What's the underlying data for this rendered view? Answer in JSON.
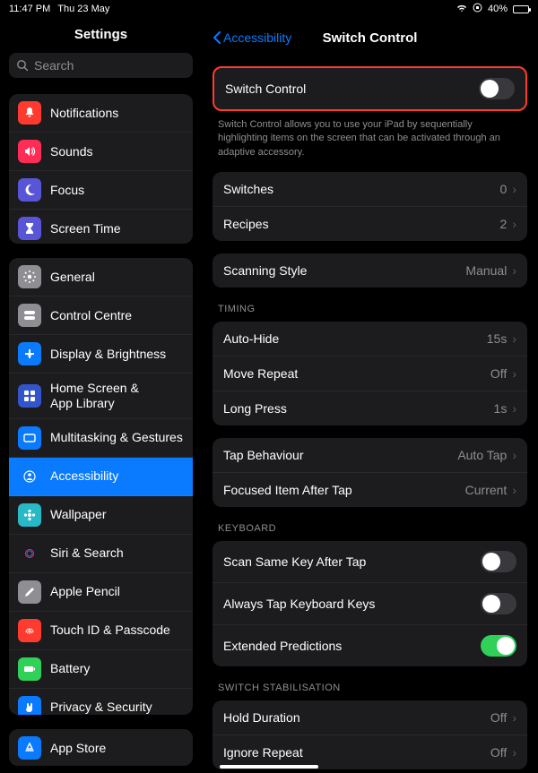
{
  "status": {
    "time": "11:47 PM",
    "date": "Thu 23 May",
    "battery": "40%"
  },
  "sidebar": {
    "title": "Settings",
    "search_placeholder": "Search",
    "group0": [
      {
        "label": "Notifications",
        "icon": "bell-icon",
        "bg": "#ff3b30"
      },
      {
        "label": "Sounds",
        "icon": "speaker-icon",
        "bg": "#ff2d55"
      },
      {
        "label": "Focus",
        "icon": "moon-icon",
        "bg": "#5856d6"
      },
      {
        "label": "Screen Time",
        "icon": "hourglass-icon",
        "bg": "#5856d6"
      }
    ],
    "group1": [
      {
        "label": "General",
        "icon": "gear-icon",
        "bg": "#8e8e93"
      },
      {
        "label": "Control Centre",
        "icon": "switches-icon",
        "bg": "#8e8e93"
      },
      {
        "label": "Display & Brightness",
        "icon": "sun-icon",
        "bg": "#0a7aff"
      },
      {
        "label": "Home Screen &\nApp Library",
        "icon": "grid-icon",
        "bg": "#3355cc"
      },
      {
        "label": "Multitasking & Gestures",
        "icon": "rect-icon",
        "bg": "#0a7aff"
      },
      {
        "label": "Accessibility",
        "icon": "person-icon",
        "bg": "#0a7aff",
        "active": true
      },
      {
        "label": "Wallpaper",
        "icon": "flower-icon",
        "bg": "#29b8c6"
      },
      {
        "label": "Siri & Search",
        "icon": "siri-icon",
        "bg": "#1c1c1e"
      },
      {
        "label": "Apple Pencil",
        "icon": "pencil-icon",
        "bg": "#8e8e93"
      },
      {
        "label": "Touch ID & Passcode",
        "icon": "fingerprint-icon",
        "bg": "#ff3b30"
      },
      {
        "label": "Battery",
        "icon": "battery-icon",
        "bg": "#30d158"
      },
      {
        "label": "Privacy & Security",
        "icon": "hand-icon",
        "bg": "#0a7aff"
      }
    ],
    "group2": [
      {
        "label": "App Store",
        "icon": "appstore-icon",
        "bg": "#0a7aff"
      }
    ]
  },
  "detail": {
    "back": "Accessibility",
    "title": "Switch Control",
    "sc": {
      "label": "Switch Control",
      "on": false
    },
    "sc_note": "Switch Control allows you to use your iPad by sequentially highlighting items on the screen that can be activated through an adaptive accessory.",
    "groupA": [
      {
        "label": "Switches",
        "value": "0"
      },
      {
        "label": "Recipes",
        "value": "2"
      }
    ],
    "scanning": {
      "label": "Scanning Style",
      "value": "Manual"
    },
    "timing_header": "TIMING",
    "timing": [
      {
        "label": "Auto-Hide",
        "value": "15s"
      },
      {
        "label": "Move Repeat",
        "value": "Off"
      },
      {
        "label": "Long Press",
        "value": "1s"
      }
    ],
    "tap": [
      {
        "label": "Tap Behaviour",
        "value": "Auto Tap"
      },
      {
        "label": "Focused Item After Tap",
        "value": "Current"
      }
    ],
    "keyboard_header": "KEYBOARD",
    "keyboard": [
      {
        "label": "Scan Same Key After Tap",
        "on": false
      },
      {
        "label": "Always Tap Keyboard Keys",
        "on": false
      },
      {
        "label": "Extended Predictions",
        "on": true
      }
    ],
    "stab_header": "SWITCH STABILISATION",
    "stab": [
      {
        "label": "Hold Duration",
        "value": "Off"
      },
      {
        "label": "Ignore Repeat",
        "value": "Off"
      }
    ]
  }
}
